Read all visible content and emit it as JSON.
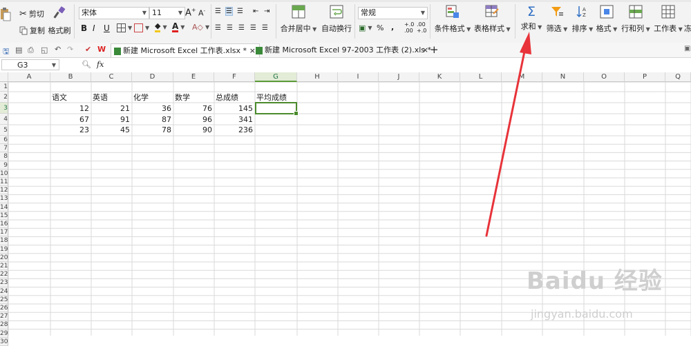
{
  "ribbon": {
    "cut": "剪切",
    "copy": "复制",
    "format_painter": "格式刷",
    "font_name": "宋体",
    "font_size": "11",
    "merge_center": "合并居中",
    "auto_wrap": "自动换行",
    "number_format": "常规",
    "conditional_format": "条件格式",
    "table_style": "表格样式",
    "sum": "求和",
    "filter": "筛选",
    "sort": "排序",
    "format": "格式",
    "row_col": "行和列",
    "worksheet": "工作表",
    "freeze": "冻",
    "percent": "%",
    "thousand": ",",
    "dec_inc": "+.0\n.00",
    "dec_dec": ".00\n+.0"
  },
  "tabs": {
    "active": "新建 Microsoft Excel 工作表.xlsx *",
    "second": "新建 Microsoft Excel 97-2003 工作表 (2).xls *",
    "add": "+"
  },
  "formula_bar": {
    "cell_ref": "G3",
    "fx": "fx"
  },
  "sheet": {
    "columns": [
      "A",
      "B",
      "C",
      "D",
      "E",
      "F",
      "G",
      "H",
      "I",
      "J",
      "K",
      "L",
      "M",
      "N",
      "O",
      "P",
      "Q"
    ],
    "row_labels": [
      "1",
      "2",
      "3",
      "4",
      "5",
      "6",
      "7",
      "8",
      "9",
      "10",
      "11",
      "12",
      "13",
      "14",
      "15",
      "16",
      "17",
      "18",
      "19",
      "20",
      "21",
      "22",
      "23",
      "24",
      "25",
      "26",
      "27",
      "28",
      "29",
      "30"
    ],
    "header_row": [
      "语文",
      "英语",
      "化学",
      "数学",
      "总成绩",
      "平均成绩"
    ],
    "rows": [
      [
        "12",
        "21",
        "36",
        "76",
        "145"
      ],
      [
        "67",
        "91",
        "87",
        "96",
        "341"
      ],
      [
        "23",
        "45",
        "78",
        "90",
        "236"
      ]
    ]
  },
  "watermark": {
    "brand": "Baidu 经验",
    "url": "jingyan.baidu.com"
  },
  "colors": {
    "accent_green": "#4a8a2c",
    "arrow_red": "#e8333a",
    "sum_blue": "#2f6fc4"
  }
}
